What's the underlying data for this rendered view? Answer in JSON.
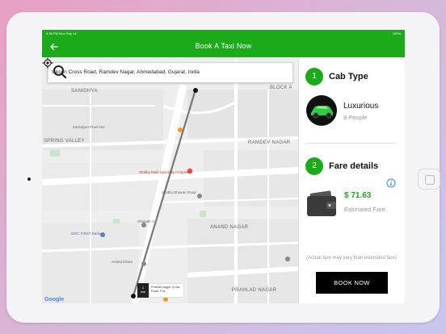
{
  "status_bar": {
    "time": "3:38 PM  Mon Sep 14",
    "battery": "100%"
  },
  "header": {
    "title": "Book A Taxi Now",
    "back_icon": "back-arrow-icon"
  },
  "colors": {
    "brand_green": "#1aaa1a",
    "button_black": "#000000",
    "route_gray": "#777777",
    "pin_red": "#e74c3c"
  },
  "map": {
    "search": {
      "value": "Iskcon Cross Road, Ramdev Nagar, Ahmedabad, Gujarat, India",
      "icon": "search-icon"
    },
    "area_labels": {
      "sanidhya": "SANIDHYA",
      "block_a": "BLOCK A",
      "spring_valley": "SPRING VALLEY",
      "ramdev_nagar": "RAMDEV NAGAR",
      "anand_nagar": "ANAND NAGAR",
      "prahlad_nagar": "PRAHLAD NAGAR"
    },
    "pois": {
      "shalby": "Shalby Multi Specialty Hospitals",
      "sindhu": "Sindhu Bhavan Road",
      "shapath": "Shapath V",
      "idfc": "IDFC FIRST Bank",
      "anand_dham": "Anand Dham",
      "kamalyan": "Kamalyan Pixel Ave"
    },
    "eta": {
      "value": "1",
      "unit": "min"
    },
    "destination_callout": "Prahlad Nagar Cross Road, Pra...",
    "attribution": "Google",
    "locate_icon": "my-location-icon"
  },
  "panel": {
    "cab_section": {
      "step": "1",
      "title": "Cab Type",
      "cab_name": "Luxurious",
      "capacity": "8 People",
      "icon": "car-icon"
    },
    "fare_section": {
      "step": "2",
      "title": "Fare details",
      "amount": "$ 71.63",
      "amount_label": "Estimated Fare",
      "info_icon": "info-icon",
      "wallet_icon": "wallet-icon"
    },
    "note": "(Actual fare may vary than estimated fare)",
    "book_button": "BOOK NOW"
  }
}
